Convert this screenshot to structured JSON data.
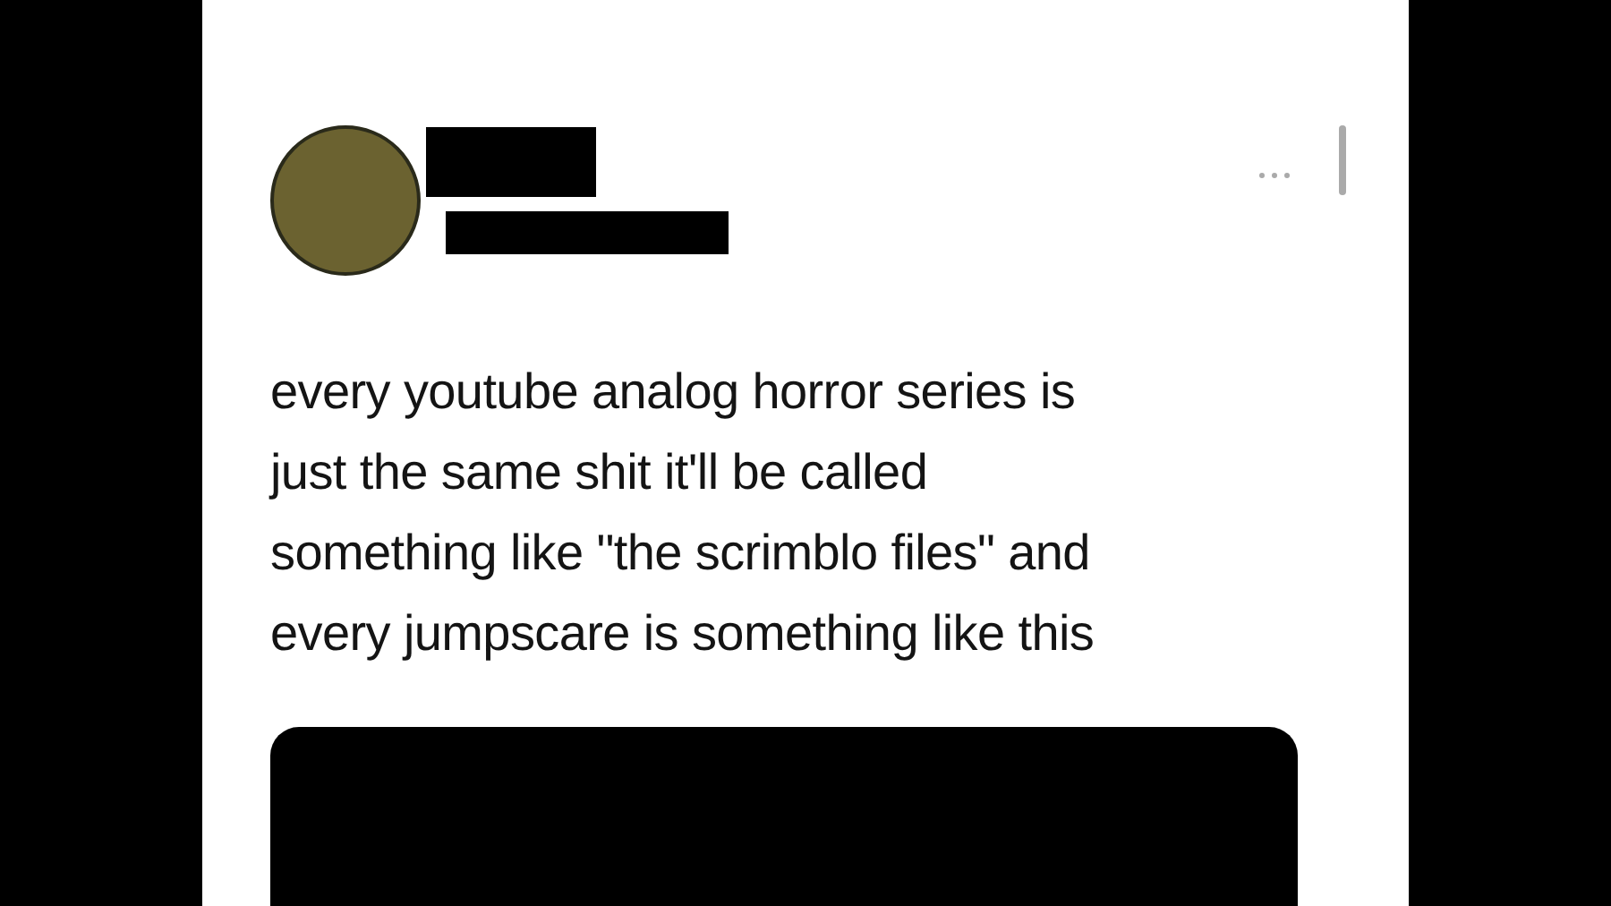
{
  "tweet": {
    "text": "every youtube analog horror series is\njust the same shit it'll be called\nsomething like \"the scrimblo files\" and\nevery jumpscare is something like this"
  }
}
